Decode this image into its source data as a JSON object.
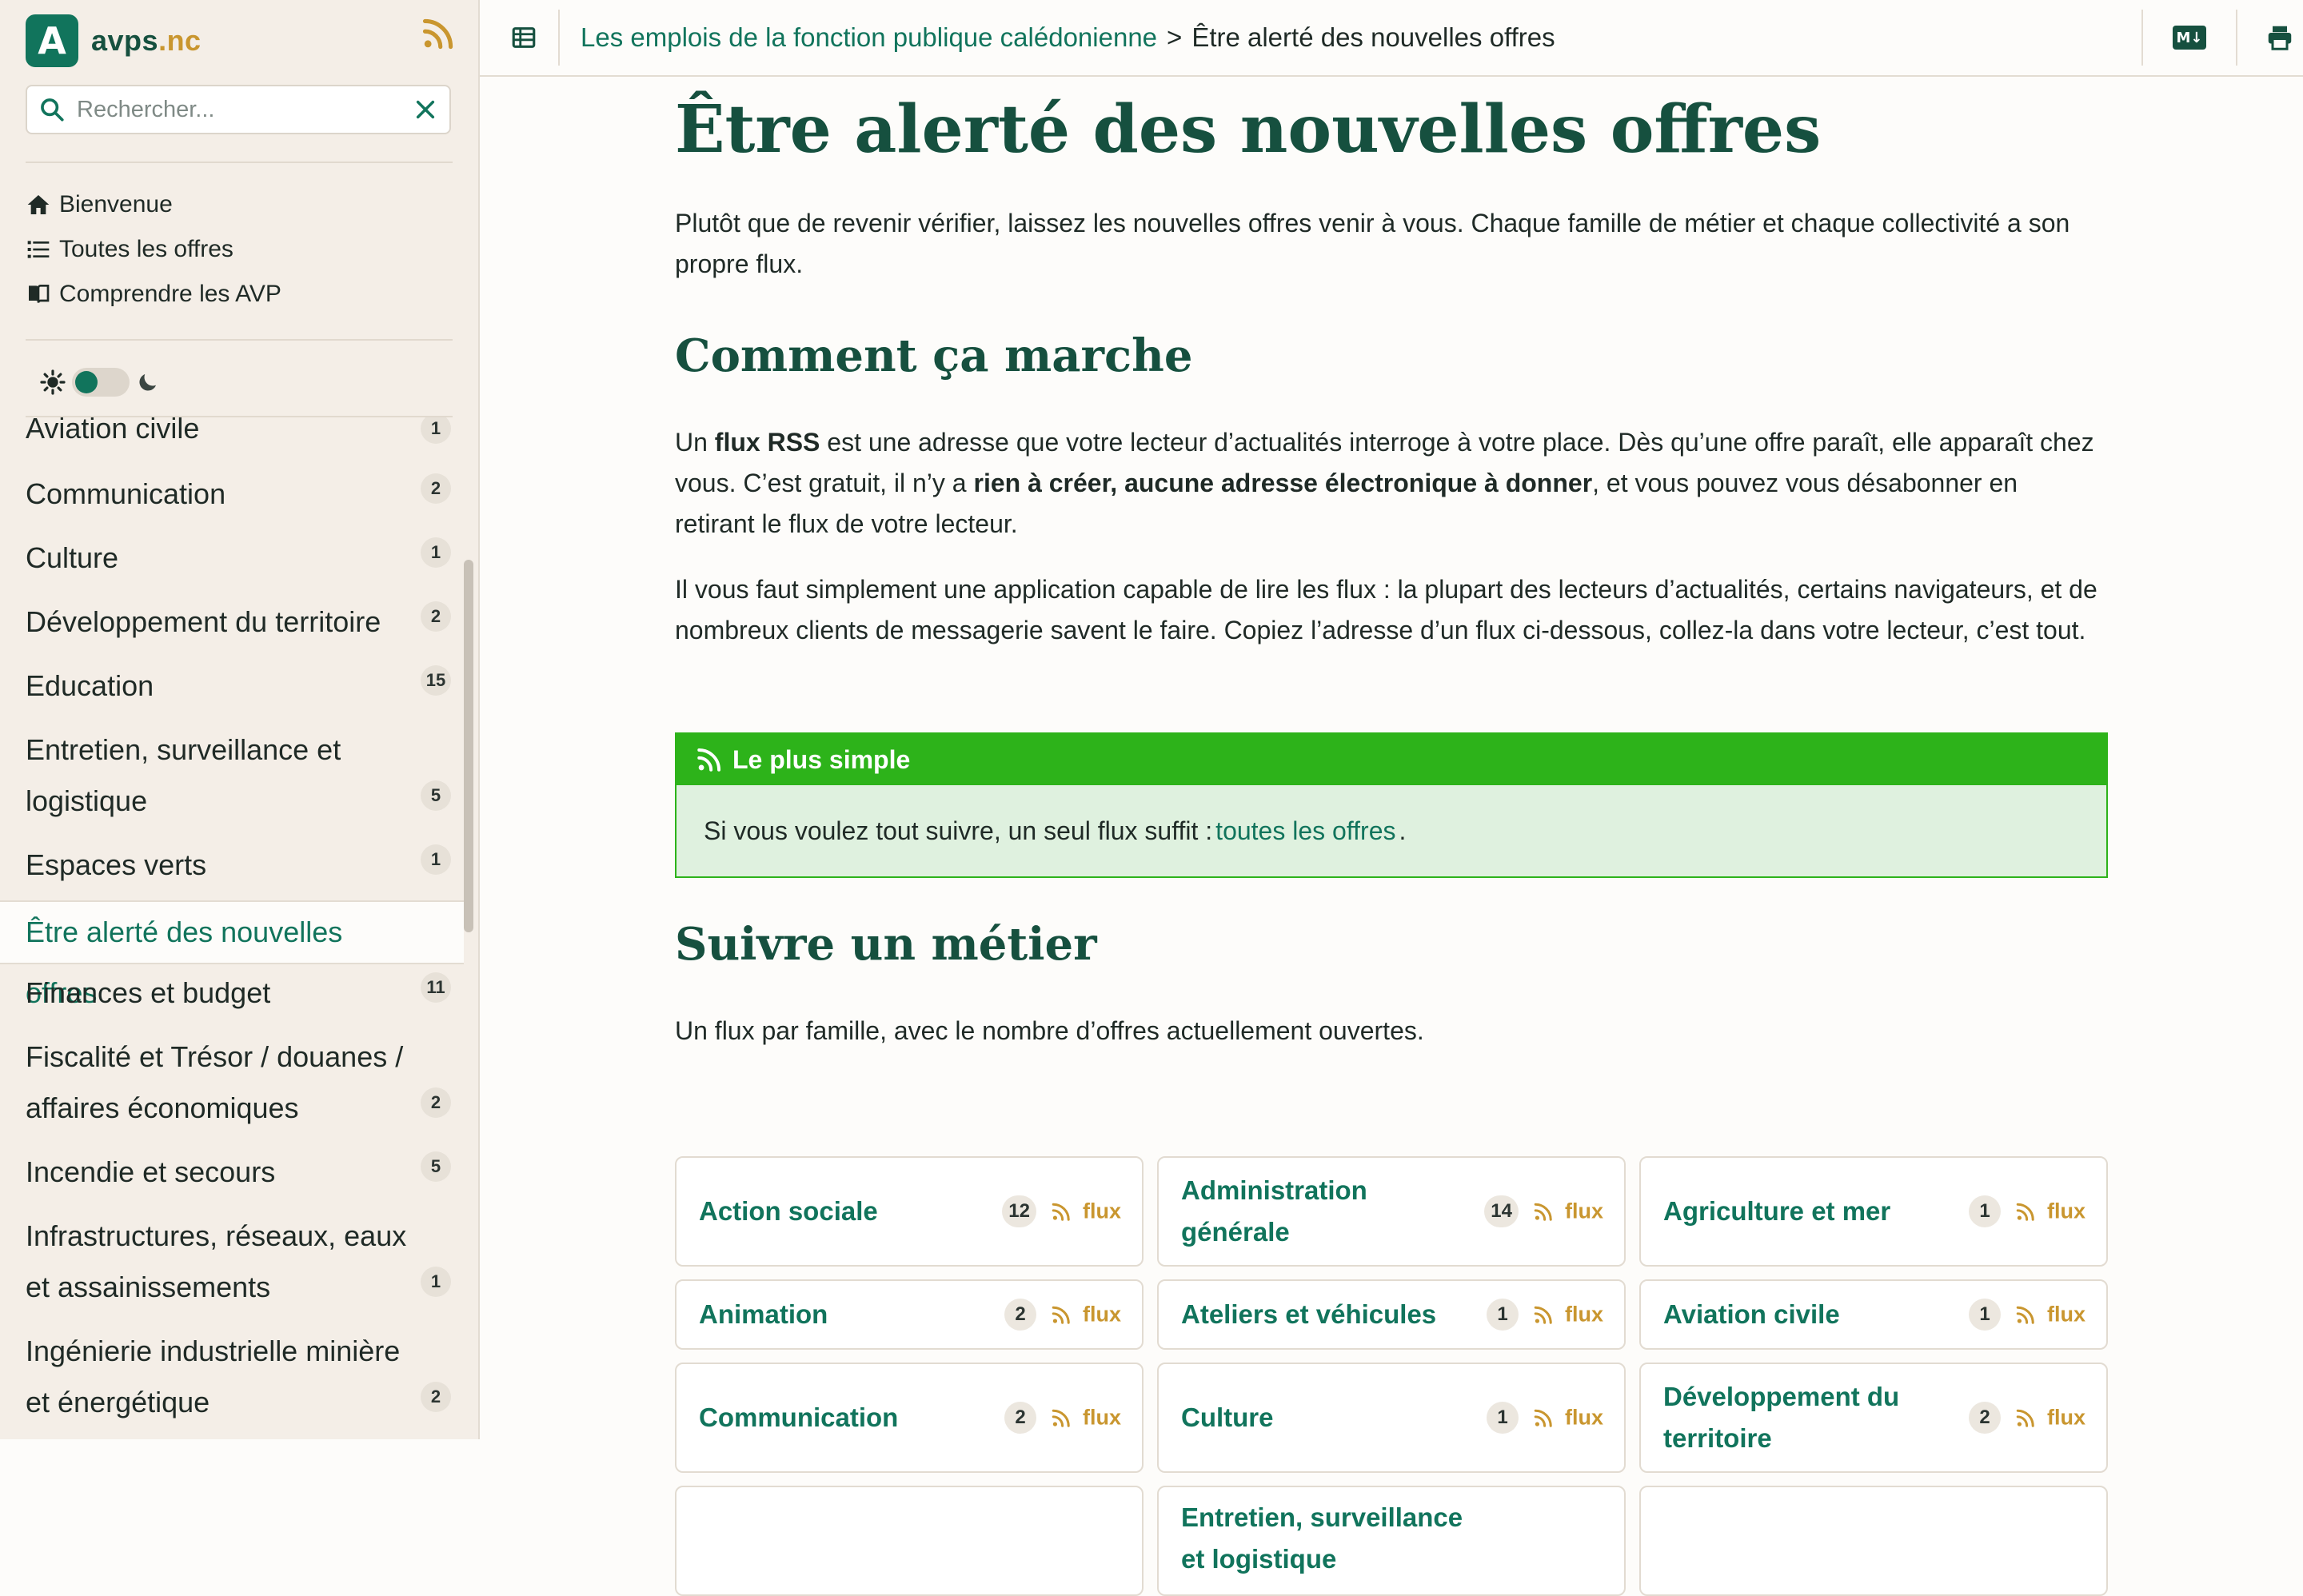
{
  "brand": {
    "logo_letter": "A",
    "name": "avps",
    "tld": ".nc"
  },
  "search": {
    "placeholder": "Rechercher..."
  },
  "topnav": [
    {
      "label": "Bienvenue",
      "icon": "home-icon"
    },
    {
      "label": "Toutes les offres",
      "icon": "list-icon"
    },
    {
      "label": "Comprendre les AVP",
      "icon": "book-icon"
    }
  ],
  "theme": {
    "light_icon": "sun-icon",
    "dark_icon": "moon-icon",
    "mode": "light"
  },
  "sidebar": {
    "categories": [
      {
        "label": "Aviation civile",
        "count": "1"
      },
      {
        "label": "Communication",
        "count": "2"
      },
      {
        "label": "Culture",
        "count": "1"
      },
      {
        "label": "Développement du territoire",
        "count": "2"
      },
      {
        "label": "Education",
        "count": "15"
      },
      {
        "label": "Entretien, surveillance et logistique",
        "count": "5"
      },
      {
        "label": "Espaces verts",
        "count": "1"
      },
      {
        "label": "Être alerté des nouvelles offres",
        "count": ""
      },
      {
        "label": "Finances et budget",
        "count": "11"
      },
      {
        "label": "Fiscalité et Trésor / douanes / affaires économiques",
        "count": "2"
      },
      {
        "label": "Incendie et secours",
        "count": "5"
      },
      {
        "label": "Infrastructures, réseaux, eaux et assainissements",
        "count": "1"
      },
      {
        "label": "Ingénierie industrielle minière et énergétique",
        "count": "2"
      }
    ]
  },
  "header": {
    "breadcrumb_parent": "Les emplois de la fonction publique calédonienne",
    "breadcrumb_sep": ">",
    "breadcrumb_current": "Être alerté des nouvelles offres",
    "markdown_label": "M↓"
  },
  "main": {
    "title": "Être alerté des nouvelles offres",
    "intro": "Plutôt que de revenir vérifier, laissez les nouvelles offres venir à vous. Chaque famille de métier et chaque collectivité a son propre flux.",
    "h2_how": "Comment ça marche",
    "how_p1_a": "Un ",
    "how_p1_b": "flux RSS",
    "how_p1_c": " est une adresse que votre lecteur d’actualités interroge à votre place. Dès qu’une offre paraît, elle apparaît chez vous. C’est gratuit, il n’y a ",
    "how_p1_d": "rien à créer, aucune adresse électronique à donner",
    "how_p1_e": ", et vous pouvez vous désabonner en retirant le flux de votre lecteur.",
    "how_p2": "Il vous faut simplement une application capable de lire les flux : la plupart des lecteurs d’actualités, certains navigateurs, et de nombreux clients de messagerie savent le faire. Copiez l’adresse d’un flux ci-dessous, collez-la dans votre lecteur, c’est tout.",
    "callout_title": "Le plus simple",
    "callout_text": "Si vous voulez tout suivre, un seul flux suffit :",
    "callout_link": "toutes les offres",
    "callout_end": ".",
    "h2_follow": "Suivre un métier",
    "follow_intro": "Un flux par famille, avec le nombre d’offres actuellement ouvertes.",
    "flux_label": "flux",
    "cards": [
      {
        "title": "Action sociale",
        "count": "12"
      },
      {
        "title": "Administration générale",
        "count": "14"
      },
      {
        "title": "Agriculture et mer",
        "count": "1"
      },
      {
        "title": "Animation",
        "count": "2"
      },
      {
        "title": "Ateliers et véhicules",
        "count": "1"
      },
      {
        "title": "Aviation civile",
        "count": "1"
      },
      {
        "title": "Communication",
        "count": "2"
      },
      {
        "title": "Culture",
        "count": "1"
      },
      {
        "title": "Développement du territoire",
        "count": "2"
      },
      {
        "title": "",
        "count": ""
      },
      {
        "title": "Entretien, surveillance et logistique",
        "count": ""
      },
      {
        "title": "",
        "count": ""
      }
    ]
  },
  "colors": {
    "accent": "#11745c",
    "heading": "#16503f",
    "rss": "#c9962f",
    "callout": "#2db31a"
  }
}
